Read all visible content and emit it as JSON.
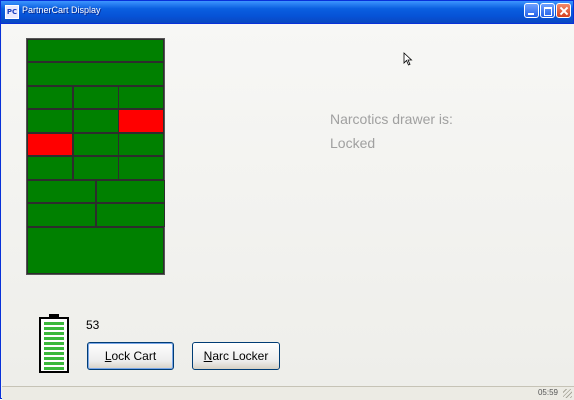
{
  "window": {
    "title": "PartnerCart Display",
    "icon": "app-icon"
  },
  "cart": {
    "drawers": [
      {
        "id": "drawer-1",
        "state": "closed",
        "color": "#008000"
      },
      {
        "id": "drawer-2",
        "state": "closed",
        "color": "#008000"
      },
      {
        "id": "drawer-3a",
        "state": "closed",
        "color": "#008000"
      },
      {
        "id": "drawer-3b",
        "state": "closed",
        "color": "#008000"
      },
      {
        "id": "drawer-3c",
        "state": "closed",
        "color": "#008000"
      },
      {
        "id": "drawer-4a",
        "state": "closed",
        "color": "#008000"
      },
      {
        "id": "drawer-4b",
        "state": "closed",
        "color": "#008000"
      },
      {
        "id": "drawer-4c",
        "state": "open",
        "color": "#ff0000"
      },
      {
        "id": "drawer-5a",
        "state": "open",
        "color": "#ff0000"
      },
      {
        "id": "drawer-5b",
        "state": "closed",
        "color": "#008000"
      },
      {
        "id": "drawer-5c",
        "state": "closed",
        "color": "#008000"
      },
      {
        "id": "drawer-6a",
        "state": "closed",
        "color": "#008000"
      },
      {
        "id": "drawer-6b",
        "state": "closed",
        "color": "#008000"
      },
      {
        "id": "drawer-6c",
        "state": "closed",
        "color": "#008000"
      },
      {
        "id": "drawer-7a",
        "state": "closed",
        "color": "#008000"
      },
      {
        "id": "drawer-7b",
        "state": "closed",
        "color": "#008000"
      },
      {
        "id": "drawer-8a",
        "state": "closed",
        "color": "#008000"
      },
      {
        "id": "drawer-8b",
        "state": "closed",
        "color": "#008000"
      },
      {
        "id": "drawer-9",
        "state": "closed",
        "color": "#008000"
      }
    ]
  },
  "narcotics": {
    "line1": "Narcotics drawer is:",
    "line2": "Locked"
  },
  "battery": {
    "value": "53",
    "level": 1.0,
    "bar_count": 10,
    "color": "#3ab83a"
  },
  "buttons": {
    "lock_cart": {
      "mnemonic": "L",
      "rest": "ock Cart"
    },
    "narc_locker": {
      "mnemonic": "N",
      "rest": "arc Locker"
    }
  },
  "statusbar": {
    "time": "05:59"
  },
  "colors": {
    "closed": "#008000",
    "open": "#ff0000",
    "titlebar": "#0652d6"
  }
}
